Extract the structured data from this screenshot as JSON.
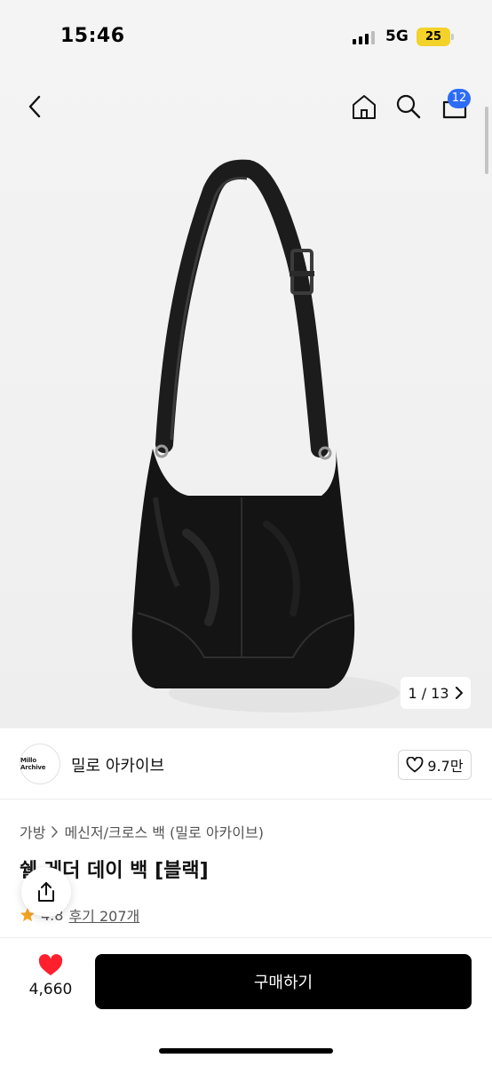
{
  "status_bar": {
    "time": "15:46",
    "network": "5G",
    "battery": "25"
  },
  "nav": {
    "cart_count": "12"
  },
  "gallery": {
    "counter": "1 / 13"
  },
  "seller": {
    "logo_text": "Millo Archive",
    "name": "밀로 아카이브",
    "likes": "9.7만"
  },
  "breadcrumb": {
    "items": [
      "가방",
      "메신저/크로스 백 (밀로 아카이브)"
    ]
  },
  "product": {
    "title": "쉘 레더 데이 백 [블랙]",
    "rating": "4.8",
    "reviews": "후기 207개"
  },
  "bottom_bar": {
    "wish_count": "4,660",
    "buy_label": "구매하기"
  },
  "colors": {
    "accent": "#2d6cf6",
    "heart": "#ff1f2d",
    "star": "#f5a623",
    "button": "#000000"
  }
}
